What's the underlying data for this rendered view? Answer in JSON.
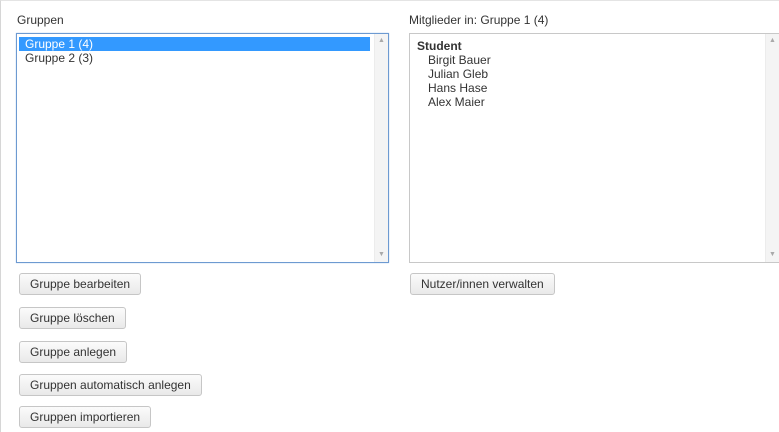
{
  "groups_panel": {
    "label": "Gruppen",
    "items": [
      {
        "label": "Gruppe 1 (4)",
        "selected": true
      },
      {
        "label": "Gruppe 2 (3)",
        "selected": false
      }
    ]
  },
  "members_panel": {
    "label": "Mitglieder in: Gruppe 1 (4)",
    "role_heading": "Student",
    "members": [
      "Birgit Bauer",
      "Julian Gleb",
      "Hans Hase",
      "Alex Maier"
    ]
  },
  "buttons": {
    "edit_group": "Gruppe bearbeiten",
    "delete_group": "Gruppe löschen",
    "create_group": "Gruppe anlegen",
    "auto_create_groups": "Gruppen automatisch anlegen",
    "import_groups": "Gruppen importieren",
    "manage_users": "Nutzer/innen verwalten"
  },
  "colors": {
    "selection": "#3399ff",
    "focus_border": "#6d9ad1"
  }
}
